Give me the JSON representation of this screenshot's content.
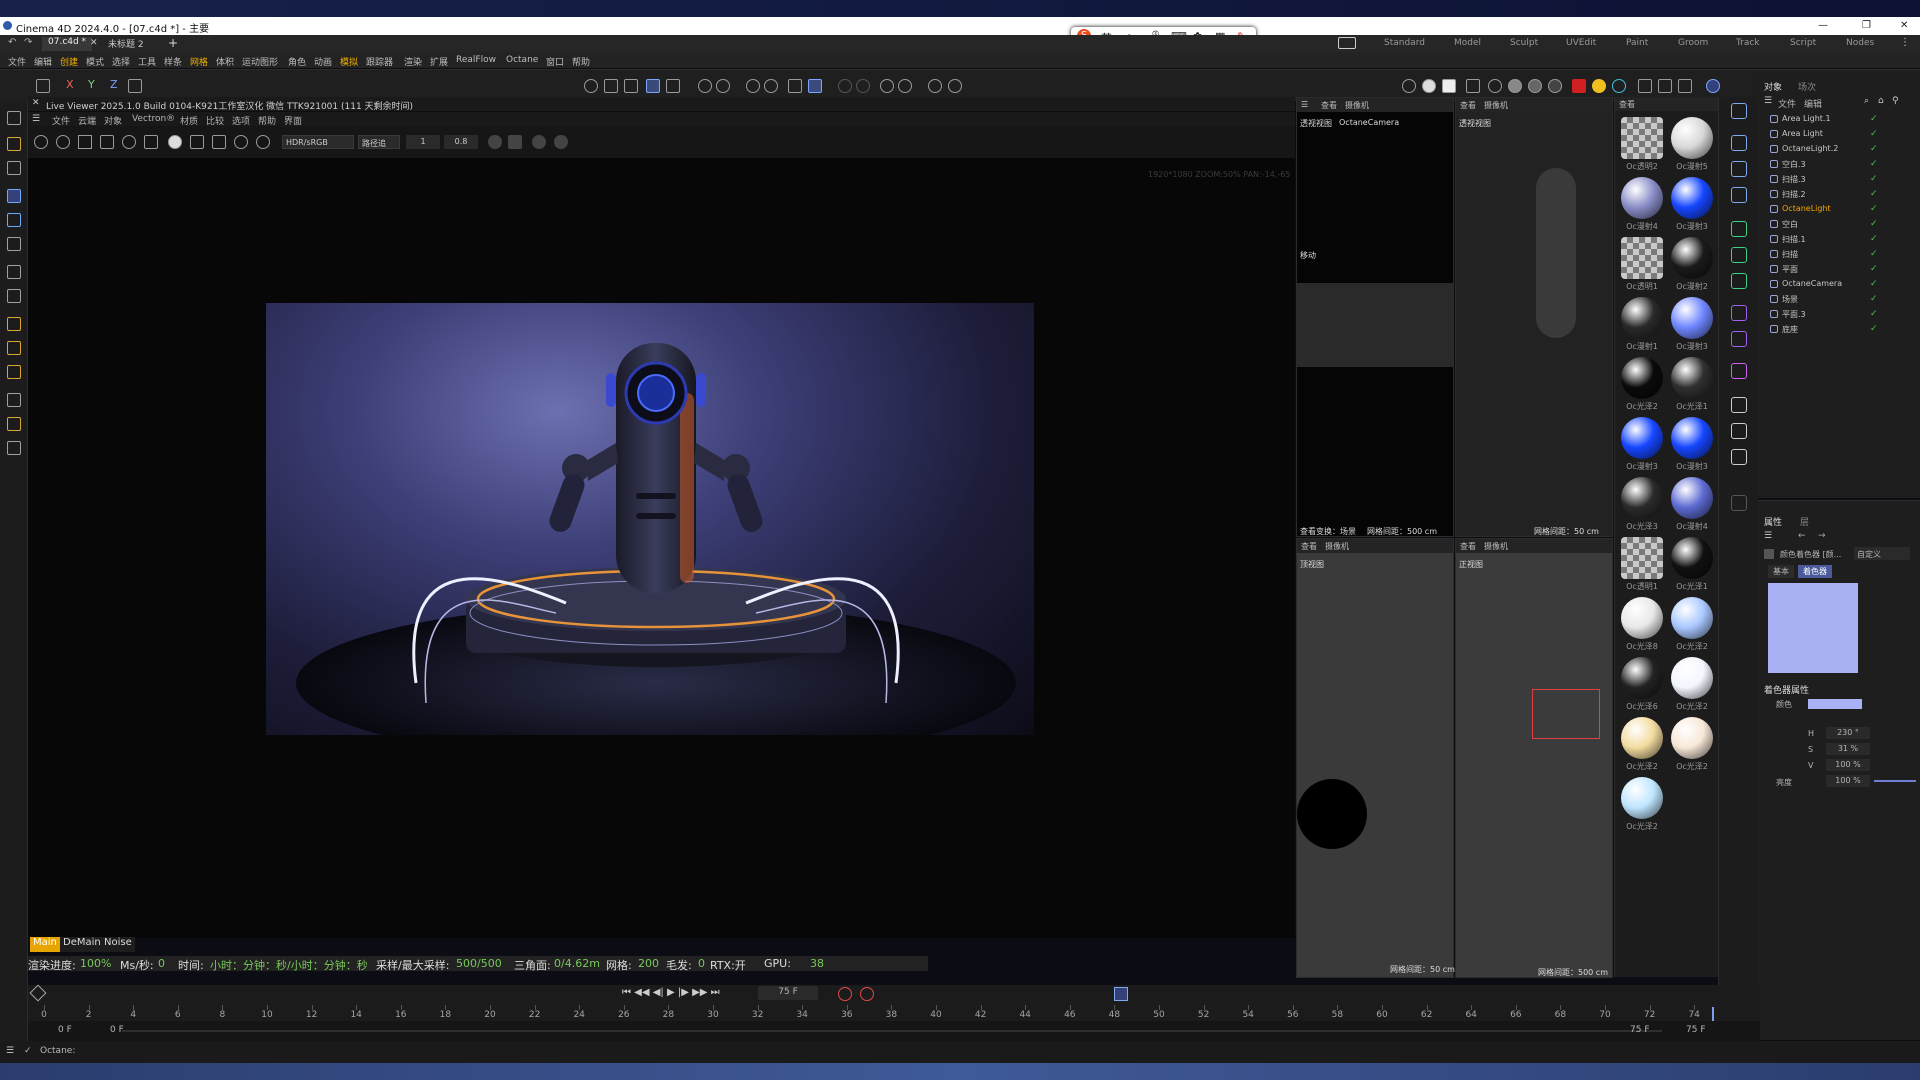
{
  "app": {
    "title": "Cinema 4D 2024.4.0 - [07.c4d *] - 主要"
  },
  "tabs": [
    {
      "label": "07.c4d *"
    },
    {
      "label": "未标题 2"
    }
  ],
  "layouts": [
    "Standard",
    "Model",
    "Sculpt",
    "UVEdit",
    "Paint",
    "Groom",
    "Track",
    "Script",
    "Nodes"
  ],
  "menu": [
    "文件",
    "编辑",
    "创建",
    "模式",
    "选择",
    "工具",
    "样条",
    "网格",
    "体积",
    "运动图形",
    "角色",
    "动画",
    "模拟",
    "跟踪器",
    "渲染",
    "扩展",
    "RealFlow",
    "Octane",
    "窗口",
    "帮助"
  ],
  "axes": [
    "X",
    "Y",
    "Z"
  ],
  "ime": {
    "lang": "英"
  },
  "liveviewer": {
    "title": "Live Viewer 2025.1.0 Build 0104-K921工作室汉化 微信 TTK921001 (111 天剩余时间)",
    "menu": [
      "文件",
      "云端",
      "对象",
      "Vectron®",
      "材质",
      "比较",
      "选项",
      "帮助",
      "界面"
    ],
    "colorspace": "HDR/sRGB",
    "mode": "路径追",
    "value1": "1",
    "value2": "0.8",
    "overlay": "1920*1080 ZOOM:50% PAN:-14,-65",
    "modes": [
      "Main",
      "DeMain",
      "Noise"
    ]
  },
  "status": {
    "progress_label": "渲染进度:",
    "progress": "100%",
    "ms_label": "Ms/秒:",
    "ms": "0",
    "time_label": "时间:",
    "time": "小时：分钟：秒/小时：分钟：秒",
    "spp_label": "采样/最大采样:",
    "spp": "500/500",
    "tri_label": "三角面:",
    "tri": "0/4.62m",
    "mesh_label": "网格:",
    "mesh": "200",
    "hair_label": "毛发:",
    "hair": "0",
    "rtx": "RTX:开",
    "gpu_label": "GPU:",
    "gpu": "38"
  },
  "viewports": {
    "head": [
      "查看",
      "摄像机"
    ],
    "persp": {
      "title": "透视视图",
      "camera": "OctaneCamera",
      "move": "移动",
      "footer": "查看变换：场景",
      "grid": "网格间距：500 cm"
    },
    "persp2": {
      "title": "透视视图",
      "grid": "网格间距：50 cm"
    },
    "top": {
      "title": "顶视图",
      "grid": "网格间距：50 cm"
    },
    "front": {
      "title": "正视图",
      "grid": "网格间距：500 cm"
    }
  },
  "materials": [
    {
      "name": "Oc透明2",
      "color": "#9a9a9a",
      "kind": "checker"
    },
    {
      "name": "Oc漫射5",
      "color": "#d8d8d8",
      "kind": "white"
    },
    {
      "name": "Oc漫射4",
      "color": "#8a8ec8",
      "kind": "pattern"
    },
    {
      "name": "Oc漫射3",
      "color": "#1646ff",
      "kind": "blue"
    },
    {
      "name": "Oc透明1",
      "color": "#9a9a9a",
      "kind": "checker"
    },
    {
      "name": "Oc漫射2",
      "color": "#1a1a1a",
      "kind": "dark"
    },
    {
      "name": "Oc漫射1",
      "color": "#2a2a2a",
      "kind": "dark"
    },
    {
      "name": "Oc漫射3",
      "color": "#6f86ff",
      "kind": "blue2"
    },
    {
      "name": "Oc光泽2",
      "color": "#0a0a0a",
      "kind": "dark"
    },
    {
      "name": "Oc光泽1",
      "color": "#303030",
      "kind": "dark"
    },
    {
      "name": "Oc漫射3",
      "color": "#1646ff",
      "kind": "blue"
    },
    {
      "name": "Oc漫射3",
      "color": "#1646ff",
      "kind": "blue"
    },
    {
      "name": "Oc光泽3",
      "color": "#2b2b2b",
      "kind": "dark"
    },
    {
      "name": "Oc漫射4",
      "color": "#5d6ad2",
      "kind": "pattern"
    },
    {
      "name": "Oc透明1",
      "color": "#9a9a9a",
      "kind": "checker"
    },
    {
      "name": "Oc光泽1",
      "color": "#111111",
      "kind": "dark"
    },
    {
      "name": "Oc光泽8",
      "color": "#e8e8e8",
      "kind": "white"
    },
    {
      "name": "Oc光泽2",
      "color": "#a9c8ff",
      "kind": "light"
    },
    {
      "name": "Oc光泽6",
      "color": "#222222",
      "kind": "dark"
    },
    {
      "name": "Oc光泽2",
      "color": "#f4f6ff",
      "kind": "white"
    },
    {
      "name": "Oc光泽2",
      "color": "#f3dca0",
      "kind": "cream"
    },
    {
      "name": "Oc光泽2",
      "color": "#f8e8d8",
      "kind": "white"
    },
    {
      "name": "Oc光泽2",
      "color": "#bfe6ff",
      "kind": "light"
    }
  ],
  "objpanel": {
    "tabs": [
      "对象",
      "场次"
    ],
    "menu": [
      "文件",
      "编辑"
    ],
    "items": [
      {
        "name": "Area Light.1",
        "hl": false
      },
      {
        "name": "Area Light",
        "hl": false
      },
      {
        "name": "OctaneLight.2",
        "hl": false
      },
      {
        "name": "空白.3",
        "hl": false
      },
      {
        "name": "扫描.3",
        "hl": false
      },
      {
        "name": "扫描.2",
        "hl": false
      },
      {
        "name": "OctaneLight",
        "hl": true
      },
      {
        "name": "空白",
        "hl": false
      },
      {
        "name": "扫描.1",
        "hl": false
      },
      {
        "name": "扫描",
        "hl": false
      },
      {
        "name": "平面",
        "hl": false
      },
      {
        "name": "OctaneCamera",
        "hl": false
      },
      {
        "name": "场景",
        "hl": false
      },
      {
        "name": "平面.3",
        "hl": false
      },
      {
        "name": "底座",
        "hl": false
      }
    ]
  },
  "attr": {
    "tabs": [
      "属性",
      "层"
    ],
    "shader": "颜色着色器 [颜...",
    "preset": "自定义",
    "subtabs": [
      "基本",
      "着色器"
    ],
    "swatch": "#aab0f4",
    "section": "着色器属性",
    "color_label": "颜色",
    "h_label": "H",
    "h": "230 °",
    "s_label": "S",
    "s": "31 %",
    "v_label": "V",
    "v": "100 %",
    "bright_label": "亮度",
    "bright": "100 %"
  },
  "timeline": {
    "frame": "75 F",
    "start": "0 F",
    "start2": "0 F",
    "end": "75 F",
    "end2": "75 F",
    "ticks": [
      "0",
      "2",
      "4",
      "6",
      "8",
      "10",
      "12",
      "14",
      "16",
      "18",
      "20",
      "22",
      "24",
      "26",
      "28",
      "30",
      "32",
      "34",
      "36",
      "38",
      "40",
      "42",
      "44",
      "46",
      "48",
      "50",
      "52",
      "54",
      "56",
      "58",
      "60",
      "62",
      "64",
      "66",
      "68",
      "70",
      "72",
      "74"
    ]
  },
  "bottom": {
    "status": "Octane:"
  }
}
